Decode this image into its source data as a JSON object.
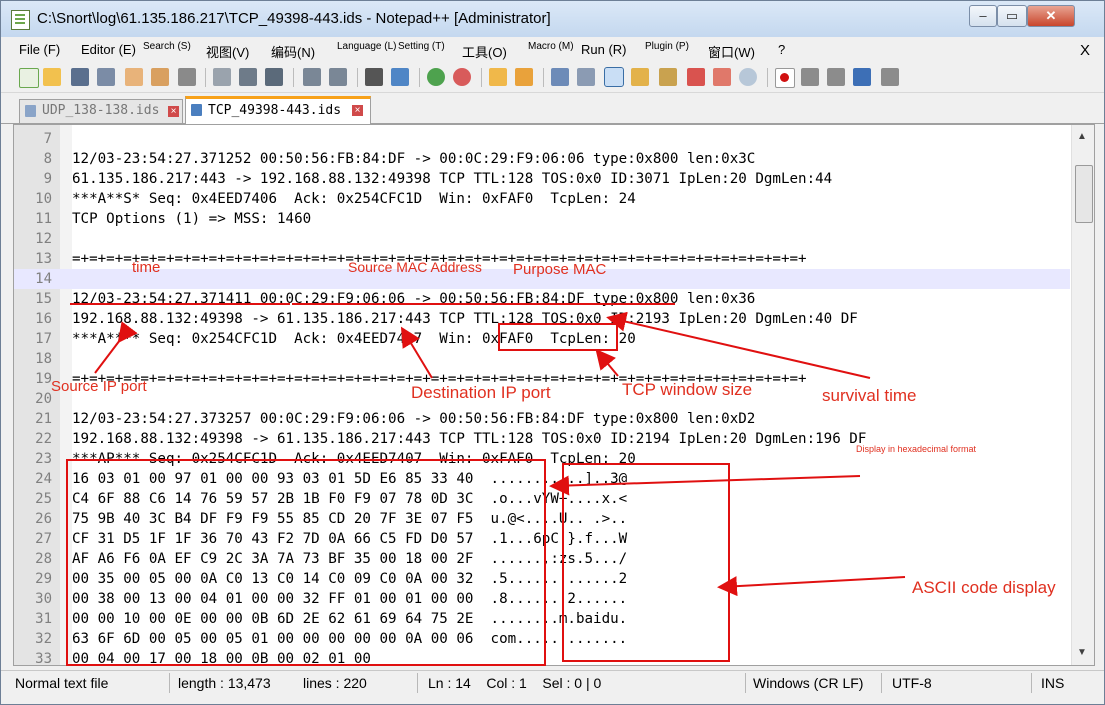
{
  "window": {
    "title": "C:\\Snort\\log\\61.135.186.217\\TCP_49398-443.ids - Notepad++ [Administrator]",
    "controls": {
      "minimize": "–",
      "maximize": "▭",
      "close": "✕"
    }
  },
  "menubar": {
    "items": [
      "File (F)",
      "Editor (E)",
      "Search (S)",
      "视图(V)",
      "编码(N)",
      "Language (L)",
      "Setting (T)",
      "工具(O)",
      "Macro (M)",
      "Run (R)",
      "Plugin (P)",
      "窗口(W)",
      "?"
    ],
    "close": "X"
  },
  "tabs": [
    {
      "label": "UDP_138-138.ids",
      "active": false
    },
    {
      "label": "TCP_49398-443.ids",
      "active": true
    }
  ],
  "editor": {
    "line_numbers": [
      "7",
      "8",
      "9",
      "10",
      "11",
      "12",
      "13",
      "14",
      "15",
      "16",
      "17",
      "18",
      "19",
      "20",
      "21",
      "22",
      "23",
      "24",
      "25",
      "26",
      "27",
      "28",
      "29",
      "30",
      "31",
      "32",
      "33"
    ],
    "lines": [
      "",
      "12/03-23:54:27.371252 00:50:56:FB:84:DF -> 00:0C:29:F9:06:06 type:0x800 len:0x3C",
      "61.135.186.217:443 -> 192.168.88.132:49398 TCP TTL:128 TOS:0x0 ID:3071 IpLen:20 DgmLen:44",
      "***A**S* Seq: 0x4EED7406  Ack: 0x254CFC1D  Win: 0xFAF0  TcpLen: 24",
      "TCP Options (1) => MSS: 1460",
      "",
      "=+=+=+=+=+=+=+=+=+=+=+=+=+=+=+=+=+=+=+=+=+=+=+=+=+=+=+=+=+=+=+=+=+=+=+=+=+=+=+=+=+=+=+",
      "",
      "12/03-23:54:27.371411 00:0C:29:F9:06:06 -> 00:50:56:FB:84:DF type:0x800 len:0x36",
      "192.168.88.132:49398 -> 61.135.186.217:443 TCP TTL:128 TOS:0x0 ID:2193 IpLen:20 DgmLen:40 DF",
      "***A**** Seq: 0x254CFC1D  Ack: 0x4EED7407  Win: 0xFAF0  TcpLen: 20",
      "",
      "=+=+=+=+=+=+=+=+=+=+=+=+=+=+=+=+=+=+=+=+=+=+=+=+=+=+=+=+=+=+=+=+=+=+=+=+=+=+=+=+=+=+=+",
      "",
      "12/03-23:54:27.373257 00:0C:29:F9:06:06 -> 00:50:56:FB:84:DF type:0x800 len:0xD2",
      "192.168.88.132:49398 -> 61.135.186.217:443 TCP TTL:128 TOS:0x0 ID:2194 IpLen:20 DgmLen:196 DF",
      "***AP*** Seq: 0x254CFC1D  Ack: 0x4EED7407  Win: 0xFAF0  TcpLen: 20",
      "16 03 01 00 97 01 00 00 93 03 01 5D E6 85 33 40  ...........]..3@",
      "C4 6F 88 C6 14 76 59 57 2B 1B F0 F9 07 78 0D 3C  .o...vYW+....x.<",
      "75 9B 40 3C B4 DF F9 F9 55 85 CD 20 7F 3E 07 F5  u.@<....U.. .>..",
      "CF 31 D5 1F 1F 36 70 43 F2 7D 0A 66 C5 FD D0 57  .1...6pC.}.f...W",
      "AF A6 F6 0A EF C9 2C 3A 7A 73 BF 35 00 18 00 2F  ......,:zs.5.../",
      "00 35 00 05 00 0A C0 13 C0 14 C0 09 C0 0A 00 32  .5.............2",
      "00 38 00 13 00 04 01 00 00 32 FF 01 00 01 00 00  .8.......2......",
      "00 00 10 00 0E 00 00 0B 6D 2E 62 61 69 64 75 2E  ........m.baidu.",
      "63 6F 6D 00 05 00 05 01 00 00 00 00 00 0A 00 06  com.............",
      "00 04 00 17 00 18 00 0B 00 02 01 00"
    ],
    "current_line": "14"
  },
  "annotations": {
    "time": "time",
    "source_mac": "Source MAC Address",
    "purpose_mac": "Purpose MAC",
    "source_ip_port": "Source IP port",
    "destination_ip_port": "Destination IP port",
    "tcp_window_size": "TCP window size",
    "survival_time": "survival time",
    "hex_format": "Display in hexadecimal format",
    "ascii_display": "ASCII code display",
    "color": "#e03020"
  },
  "statusbar": {
    "file_type": "Normal text file",
    "length": "length : 13,473",
    "lines": "lines : 220",
    "position": "Ln : 14    Col : 1    Sel : 0 | 0",
    "eol": "Windows (CR LF)",
    "encoding": "UTF-8",
    "mode": "INS"
  }
}
